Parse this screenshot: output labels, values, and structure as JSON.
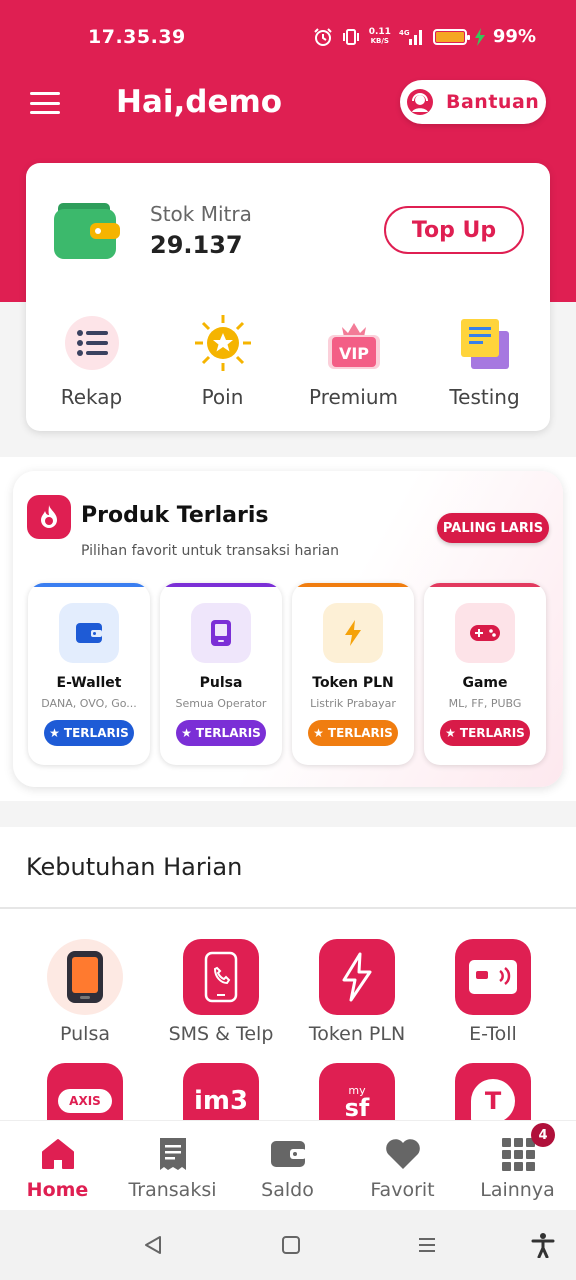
{
  "status_bar": {
    "time": "17.35.39",
    "net_speed": "0.11",
    "net_unit": "KB/S",
    "battery": "99%",
    "battery_level": 0.99
  },
  "header": {
    "greeting": "Hai,demo",
    "help_label": "Bantuan"
  },
  "wallet": {
    "stok_label": "Stok Mitra",
    "stok_value": "29.137",
    "topup_label": "Top Up"
  },
  "quick_menu": [
    {
      "label": "Rekap",
      "icon": "list-icon"
    },
    {
      "label": "Poin",
      "icon": "star-badge-icon"
    },
    {
      "label": "Premium",
      "icon": "vip-icon"
    },
    {
      "label": "Testing",
      "icon": "notes-icon"
    }
  ],
  "produk": {
    "title": "Produk Terlaris",
    "subtitle": "Pilihan favorit untuk transaksi harian",
    "badge": "PALING LARIS",
    "items": [
      {
        "name": "E-Wallet",
        "desc": "DANA, OVO, Go...",
        "badge": "TERLARIS",
        "color": "#1e5bd6",
        "icon": "wallet-icon"
      },
      {
        "name": "Pulsa",
        "desc": "Semua Operator",
        "badge": "TERLARIS",
        "color": "#7b2fd6",
        "icon": "phone-icon"
      },
      {
        "name": "Token PLN",
        "desc": "Listrik Prabayar",
        "badge": "TERLARIS",
        "color": "#f07d10",
        "icon": "bolt-icon"
      },
      {
        "name": "Game",
        "desc": "ML, FF, PUBG",
        "badge": "TERLARIS",
        "color": "#d81b48",
        "icon": "gamepad-icon"
      }
    ]
  },
  "kebutuhan": {
    "title": "Kebutuhan Harian",
    "items": [
      {
        "label": "Pulsa",
        "icon": "phone-icon"
      },
      {
        "label": "SMS & Telp",
        "icon": "phone-call-icon"
      },
      {
        "label": "Token PLN",
        "icon": "bolt-icon"
      },
      {
        "label": "E-Toll",
        "icon": "etoll-card-icon"
      },
      {
        "label": "",
        "icon": "axis-logo"
      },
      {
        "label": "",
        "icon": "im3-logo"
      },
      {
        "label": "",
        "icon": "smartfren-logo"
      },
      {
        "label": "",
        "icon": "telkomsel-logo"
      }
    ],
    "axis_text": "AXIS",
    "im3_text": "im3",
    "sf_text": "sf",
    "my_text": "my",
    "tsel_text": "T"
  },
  "bottom_nav": {
    "items": [
      {
        "label": "Home",
        "icon": "home-icon"
      },
      {
        "label": "Transaksi",
        "icon": "receipt-icon"
      },
      {
        "label": "Saldo",
        "icon": "wallet-icon"
      },
      {
        "label": "Favorit",
        "icon": "heart-icon"
      },
      {
        "label": "Lainnya",
        "icon": "grid-icon"
      }
    ],
    "lainnya_badge": "4"
  },
  "colors": {
    "primary": "#df1f52",
    "background": "#f4f4f4"
  }
}
